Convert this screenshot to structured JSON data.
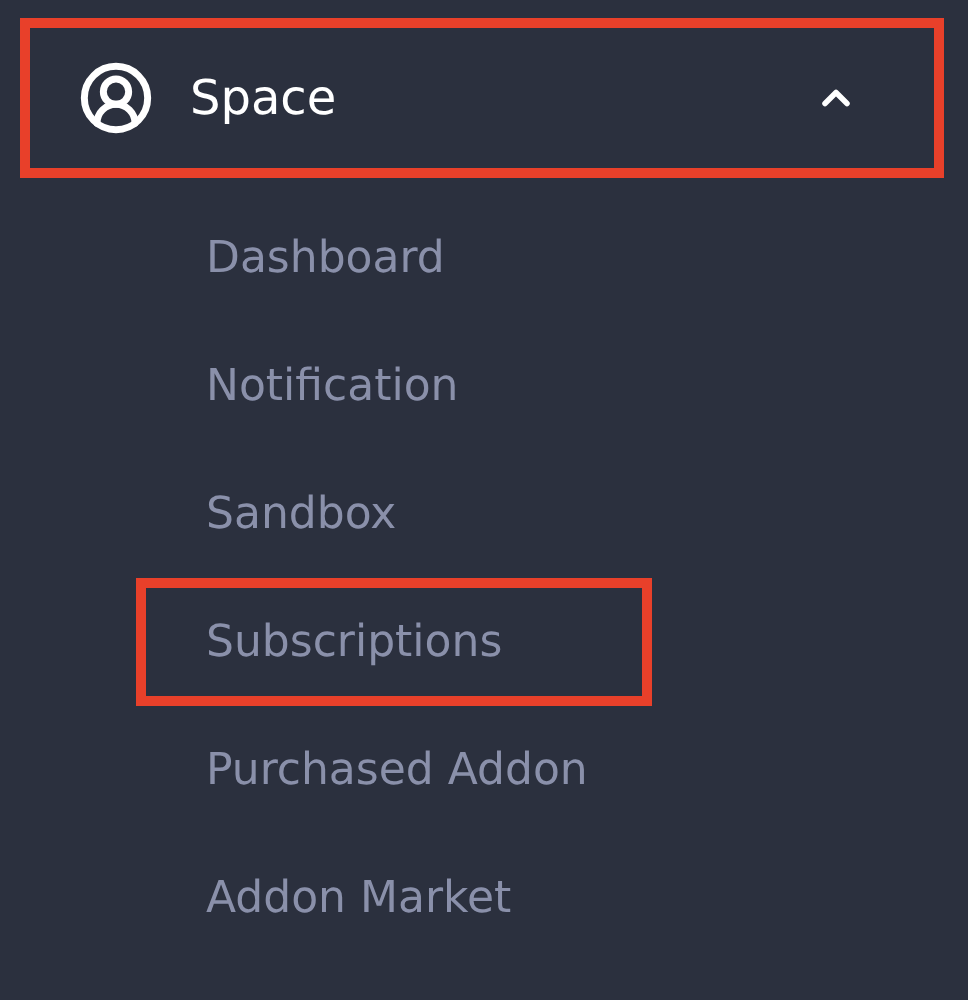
{
  "menu_group": {
    "label": "Space",
    "expanded": true,
    "highlighted": true
  },
  "items": [
    {
      "label": "Dashboard",
      "highlighted": false
    },
    {
      "label": "Notification",
      "highlighted": false
    },
    {
      "label": "Sandbox",
      "highlighted": false
    },
    {
      "label": "Subscriptions",
      "highlighted": true
    },
    {
      "label": "Purchased Addon",
      "highlighted": false
    },
    {
      "label": "Addon Market",
      "highlighted": false
    }
  ]
}
